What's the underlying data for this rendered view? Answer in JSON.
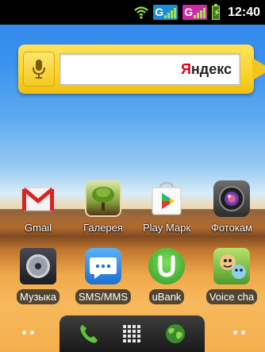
{
  "status_bar": {
    "network_1": "G",
    "network_2": "G",
    "time": "12:40",
    "colors": {
      "net1_bg": "#1a8fd1",
      "net2_bg": "#cc2aa6",
      "signal": "#9ee34b"
    }
  },
  "search_widget": {
    "brand_first_letter": "Я",
    "brand_rest": "ндекс",
    "icons": {
      "mic": "microphone-icon"
    }
  },
  "apps_row1": [
    {
      "label": "Gmail",
      "icon": "gmail-icon"
    },
    {
      "label": "Галерея",
      "icon": "gallery-icon"
    },
    {
      "label": "Play Марк",
      "icon": "play-market-icon"
    },
    {
      "label": "Фотокам",
      "icon": "camera-icon"
    }
  ],
  "apps_row2": [
    {
      "label": "Музыка",
      "icon": "music-icon"
    },
    {
      "label": "SMS/MMS",
      "icon": "sms-icon"
    },
    {
      "label": "uBank",
      "icon": "ubank-icon"
    },
    {
      "label": "Voice cha",
      "icon": "voice-changer-icon"
    }
  ],
  "dock": {
    "left_dots": "••",
    "right_dots": "••",
    "icons": [
      "phone-icon",
      "apps-grid-icon",
      "browser-globe-icon"
    ]
  }
}
